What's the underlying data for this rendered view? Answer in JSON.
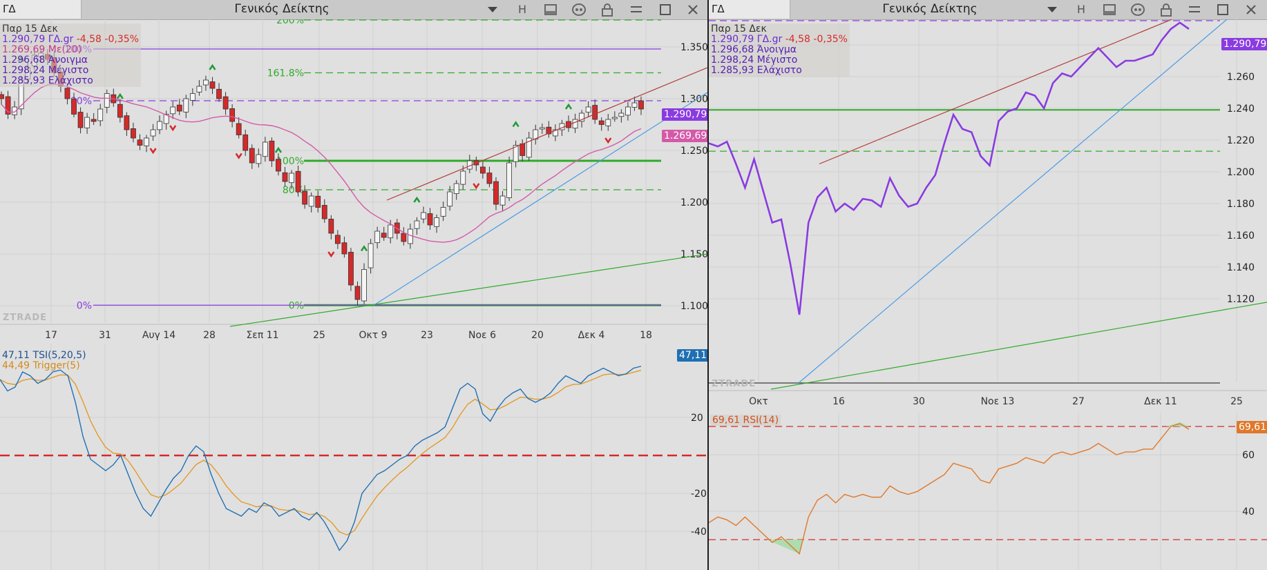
{
  "left_window": {
    "symbol": "ΓΔ",
    "title": "Γενικός Δείκτης",
    "toolbar_h": "H",
    "price_info": {
      "date": "Παρ 15 Δεκ",
      "last": "1.290,79",
      "name": "ΓΔ.gr",
      "change": "-4,58",
      "change_pct": "-0,35%",
      "ma_value": "1.269,69",
      "ma_label": "Με(20)",
      "open_value": "1.296,68",
      "open_label": "Άνοιγμα",
      "high_value": "1.298,24",
      "high_label": "Μέγιστο",
      "low_value": "1.285,93",
      "low_label": "Ελάχιστο"
    },
    "price_tags": {
      "last": "1.290,79",
      "ma": "1.269,69"
    },
    "watermark": "ZTRADE",
    "fib_labels": [
      "200%",
      "161.8%",
      "100%",
      "80%",
      "0%"
    ],
    "fib_labels_left": [
      "100%",
      "80%",
      "0%"
    ],
    "price_axis": [
      "1.350",
      "1.300",
      "1.250",
      "1.200",
      "1.150",
      "1.100"
    ],
    "date_axis": [
      "17",
      "31",
      "Αυγ 14",
      "28",
      "Σεπ 11",
      "25",
      "Οκτ 9",
      "23",
      "Νοε 6",
      "20",
      "Δεκ 4",
      "18"
    ],
    "indicator": {
      "tsi_value": "47,11",
      "tsi_label": "TSI(5,20,5)",
      "trigger_value": "44,49",
      "trigger_label": "Trigger(5)",
      "axis": [
        "20",
        "-20",
        "-40"
      ],
      "tag": "47,11"
    }
  },
  "right_window": {
    "symbol": "ΓΔ",
    "title": "Γενικός Δείκτης",
    "toolbar_h": "H",
    "price_info": {
      "date": "Παρ 15 Δεκ",
      "last": "1.290,79",
      "name": "ΓΔ.gr",
      "change": "-4,58",
      "change_pct": "-0,35%",
      "open_value": "1.296,68",
      "open_label": "Άνοιγμα",
      "high_value": "1.298,24",
      "high_label": "Μέγιστο",
      "low_value": "1.285,93",
      "low_label": "Ελάχιστο"
    },
    "price_tag": "1.290,79",
    "watermark": "ZTRADE",
    "price_axis": [
      "1.280",
      "1.260",
      "1.240",
      "1.220",
      "1.200",
      "1.180",
      "1.160",
      "1.140",
      "1.120"
    ],
    "date_axis": [
      "Οκτ",
      "16",
      "30",
      "Νοε 13",
      "27",
      "Δεκ 11",
      "25"
    ],
    "indicator": {
      "rsi_value": "69,61",
      "rsi_label": "RSI(14)",
      "axis": [
        "60",
        "40"
      ],
      "tag": "69,61"
    }
  },
  "colors": {
    "bull": "#f5f5f5",
    "bear": "#d42a2a",
    "ma": "#d45aa8",
    "fib": "#2faa2a",
    "violet": "#8a3be0",
    "tsi": "#1f6fb3",
    "trigger": "#e39b2a",
    "rsi": "#e0782a",
    "trend_up": "#b33a3a",
    "trend_blue": "#4a9ae6"
  },
  "chart_data": [
    {
      "type": "candlestick",
      "title": "Γενικός Δείκτης",
      "x": [
        "17",
        "31",
        "Αυγ 14",
        "28",
        "Σεπ 11",
        "25",
        "Οκτ 9",
        "23",
        "Νοε 6",
        "20",
        "Δεκ 4",
        "18"
      ],
      "ylim": [
        1090,
        1370
      ],
      "close": [
        1300,
        1285,
        1292,
        1318,
        1330,
        1342,
        1344,
        1338,
        1325,
        1312,
        1300,
        1285,
        1272,
        1282,
        1278,
        1290,
        1305,
        1296,
        1282,
        1270,
        1262,
        1255,
        1262,
        1270,
        1278,
        1285,
        1292,
        1288,
        1300,
        1305,
        1312,
        1318,
        1310,
        1300,
        1290,
        1278,
        1265,
        1250,
        1238,
        1246,
        1258,
        1240,
        1230,
        1220,
        1228,
        1210,
        1198,
        1206,
        1195,
        1184,
        1170,
        1160,
        1150,
        1120,
        1106,
        1135,
        1160,
        1172,
        1166,
        1178,
        1170,
        1162,
        1174,
        1182,
        1190,
        1178,
        1185,
        1195,
        1210,
        1218,
        1230,
        1240,
        1236,
        1228,
        1218,
        1198,
        1206,
        1238,
        1255,
        1245,
        1262,
        1270,
        1272,
        1266,
        1270,
        1276,
        1272,
        1280,
        1286,
        1292,
        1280,
        1275,
        1280,
        1282,
        1286,
        1292,
        1296,
        1290
      ],
      "series": [
        {
          "name": "Με(20)",
          "last": 1269.69
        },
        {
          "name": "Fibonacci 0%",
          "y": 1100.5
        },
        {
          "name": "Fibonacci 80% (left)",
          "y": 1298
        },
        {
          "name": "Fibonacci 100% (left)",
          "y": 1348
        }
      ]
    },
    {
      "type": "line",
      "title": "TSI(5,20,5)",
      "series": [
        {
          "name": "TSI(5,20,5)",
          "last": 47.11,
          "values": [
            40,
            34,
            36,
            44,
            42,
            38,
            40,
            44,
            45,
            42,
            28,
            10,
            -2,
            -5,
            -8,
            -5,
            0,
            -10,
            -20,
            -28,
            -32,
            -25,
            -18,
            -12,
            -8,
            0,
            5,
            2,
            -10,
            -20,
            -28,
            -30,
            -32,
            -28,
            -30,
            -25,
            -27,
            -32,
            -30,
            -28,
            -32,
            -34,
            -30,
            -35,
            -42,
            -50,
            -45,
            -35,
            -20,
            -15,
            -10,
            -8,
            -5,
            -2,
            0,
            5,
            8,
            10,
            12,
            15,
            25,
            35,
            38,
            35,
            22,
            18,
            25,
            30,
            33,
            35,
            30,
            28,
            30,
            33,
            38,
            42,
            40,
            38,
            42,
            44,
            46,
            44,
            42,
            43,
            46,
            47
          ]
        },
        {
          "name": "Trigger(5)",
          "last": 44.49
        }
      ],
      "ylim": [
        -50,
        55
      ],
      "reference_line": 0
    },
    {
      "type": "line",
      "title": "Γενικός Δείκτης",
      "x": [
        "Οκτ",
        "16",
        "30",
        "Νοε 13",
        "27",
        "Δεκ 11",
        "25"
      ],
      "ylim": [
        1100,
        1295
      ],
      "series": [
        {
          "name": "ΓΔ.gr",
          "values": [
            1218,
            1216,
            1219,
            1205,
            1190,
            1208,
            1188,
            1168,
            1170,
            1142,
            1110,
            1168,
            1184,
            1190,
            1175,
            1180,
            1176,
            1183,
            1182,
            1178,
            1196,
            1185,
            1178,
            1180,
            1190,
            1198,
            1218,
            1236,
            1227,
            1225,
            1210,
            1204,
            1232,
            1238,
            1240,
            1250,
            1248,
            1240,
            1256,
            1262,
            1260,
            1266,
            1272,
            1278,
            1272,
            1266,
            1270,
            1270,
            1272,
            1274,
            1283,
            1290,
            1294,
            1290
          ]
        }
      ],
      "reference_line": 1239
    },
    {
      "type": "line",
      "title": "RSI(14)",
      "series": [
        {
          "name": "RSI(14)",
          "last": 69.61,
          "values": [
            36,
            38,
            37,
            35,
            38,
            35,
            32,
            29,
            31,
            28,
            25,
            38,
            44,
            46,
            43,
            46,
            45,
            46,
            45,
            45,
            49,
            47,
            46,
            47,
            49,
            51,
            53,
            57,
            56,
            55,
            51,
            50,
            55,
            56,
            57,
            59,
            58,
            57,
            60,
            61,
            60,
            61,
            62,
            64,
            62,
            60,
            61,
            61,
            62,
            62,
            66,
            70,
            71,
            69
          ]
        }
      ],
      "reference_lines": [
        30,
        70
      ],
      "ylim": [
        25,
        75
      ]
    }
  ]
}
